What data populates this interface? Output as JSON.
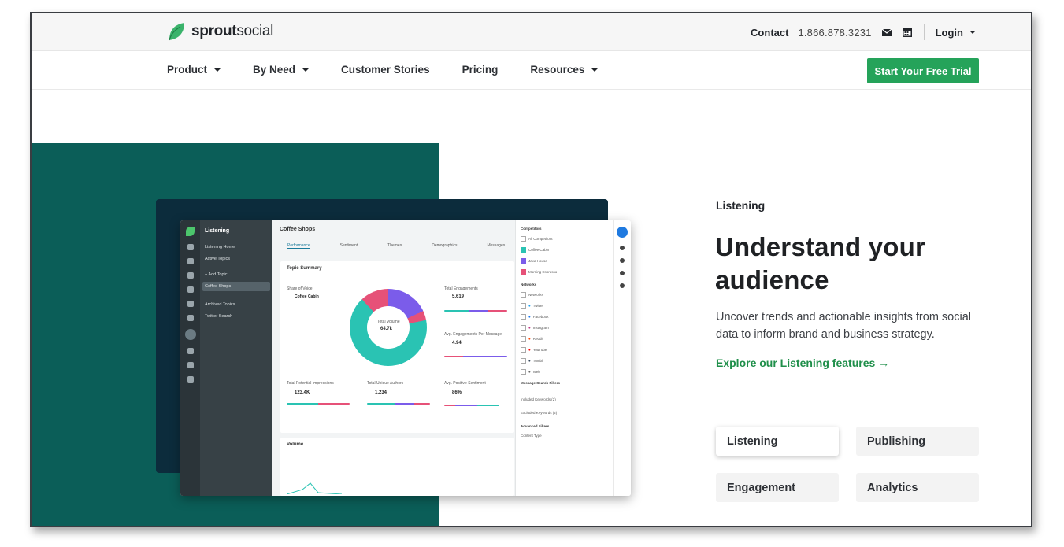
{
  "brand": {
    "name_bold": "sprout",
    "name_rest": "social",
    "green": "#25a35a",
    "leaf_color": "#3ab36b"
  },
  "topbar": {
    "contact": "Contact",
    "phone": "1.866.878.3231",
    "login": "Login"
  },
  "nav": {
    "items": [
      "Product",
      "By Need",
      "Customer Stories",
      "Pricing",
      "Resources"
    ],
    "cta": "Start Your Free Trial"
  },
  "app_preview": {
    "sidebar_title": "Listening",
    "sidebar_items": [
      "Listening Home",
      "Active Topics",
      "+ Add Topic",
      "Coffee Shops",
      "Archived Topics",
      "Twitter Search"
    ],
    "main_title": "Coffee Shops",
    "tabs": [
      "Performance",
      "Sentiment",
      "Themes",
      "Demographics",
      "Messages"
    ],
    "card_title": "Topic Summary",
    "share_of_voice": "Share of Voice",
    "brand_name": "Coffee Cabin",
    "donut_label": "Total Volume",
    "donut_value": "64.7k",
    "total_engagements_label": "Total Engagements",
    "total_engagements": "5,619",
    "avg_engagements_label": "Avg. Engagements Per Message",
    "avg_engagements": "4.94",
    "impressions_label": "Total Potential Impressions",
    "impressions": "123.4K",
    "unique_authors_label": "Total Unique Authors",
    "unique_authors": "1,234",
    "sentiment_label": "Avg. Positive Sentiment",
    "sentiment": "86%",
    "volume_title": "Volume",
    "filters": [
      "Competitors",
      "All Competitors",
      "Coffee Cabin",
      "Java House",
      "Morning Espresso",
      "Networks",
      "Networks",
      "Twitter",
      "Facebook",
      "Instagram",
      "Reddit",
      "YouTube",
      "Tumblr",
      "Web",
      "Message Search Filters",
      "Included Keywords (2)",
      "Excluded Keywords (2)",
      "Advanced Filters",
      "Content Type"
    ]
  },
  "hero": {
    "eyebrow": "Listening",
    "headline": "Understand your audience",
    "body": "Uncover trends and actionable insights from social data to inform brand and business strategy.",
    "link": "Explore our Listening features →",
    "tabs": [
      "Listening",
      "Publishing",
      "Engagement",
      "Analytics"
    ]
  },
  "colors": {
    "teal": "#0b5e58",
    "navy": "#0c2c3c",
    "link_green": "#1f8f4a"
  }
}
